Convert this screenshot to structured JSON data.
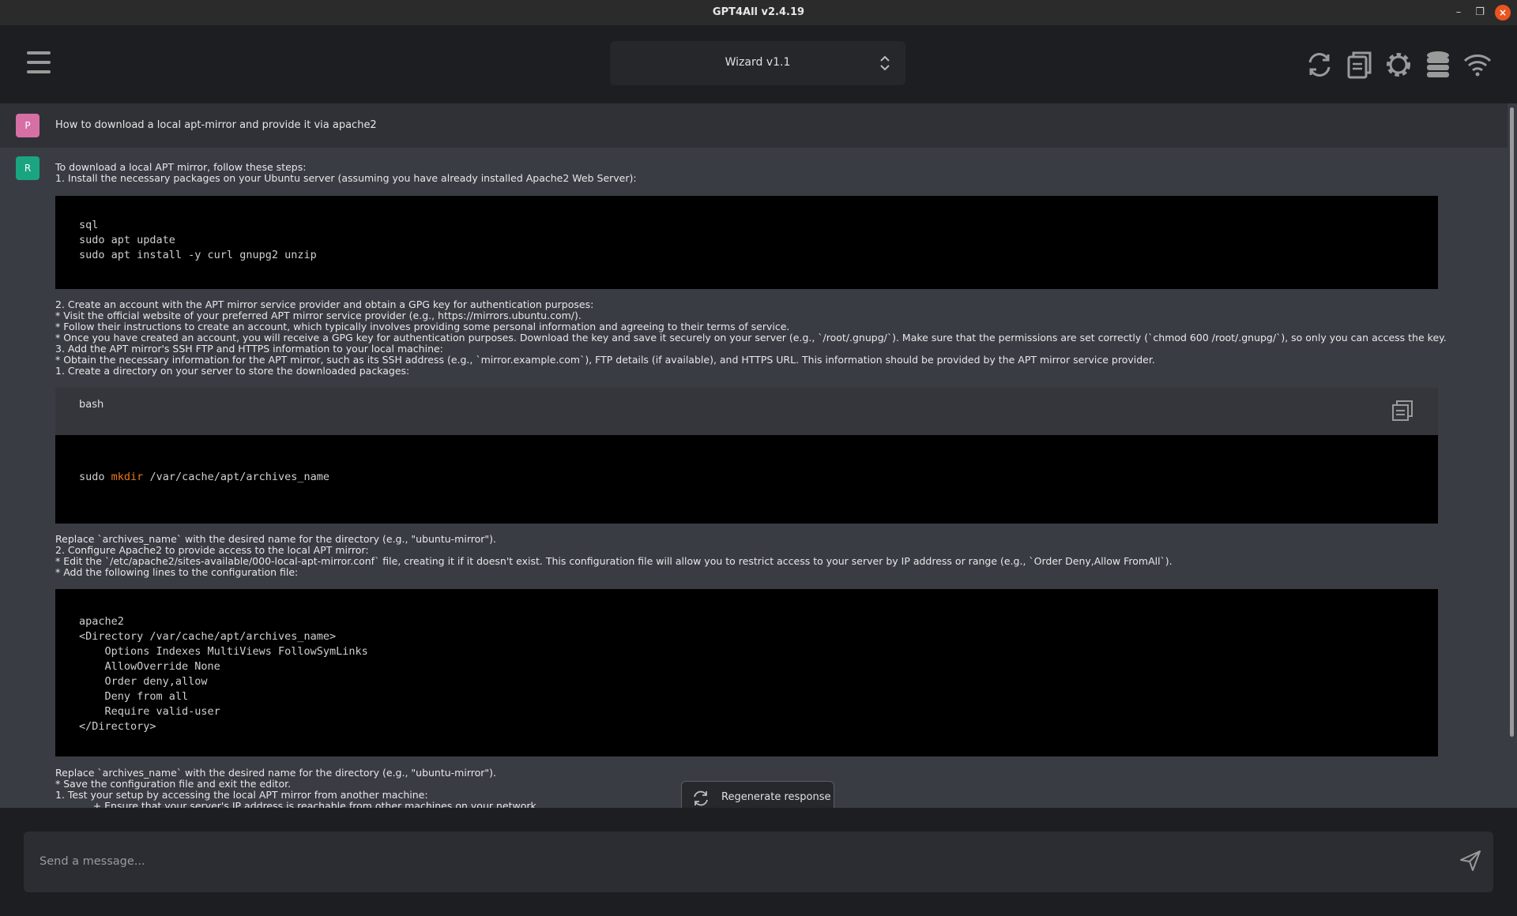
{
  "window": {
    "title": "GPT4All v2.4.19",
    "minimize": "–",
    "maximize": "❐",
    "close": "×"
  },
  "header": {
    "model_name": "Wizard v1.1"
  },
  "conversation": {
    "prompt_avatar": "P",
    "prompt_text": "How to download a local apt-mirror and provide it via apache2",
    "response_avatar": "R",
    "p1": "To download a local APT mirror, follow these steps:\n1. Install the necessary packages on your Ubuntu server (assuming you have already installed Apache2 Web Server):",
    "code1": "sql\nsudo apt update\nsudo apt install -y curl gnupg2 unzip",
    "p2": "2. Create an account with the APT mirror service provider and obtain a GPG key for authentication purposes:\n* Visit the official website of your preferred APT mirror service provider (e.g., https://mirrors.ubuntu.com/).\n* Follow their instructions to create an account, which typically involves providing some personal information and agreeing to their terms of service.\n* Once you have created an account, you will receive a GPG key for authentication purposes. Download the key and save it securely on your server (e.g., `/root/.gnupg/`). Make sure that the permissions are set correctly (`chmod 600 /root/.gnupg/`), so only you can access the key.\n3. Add the APT mirror's SSH FTP and HTTPS information to your local machine:\n* Obtain the necessary information for the APT mirror, such as its SSH address (e.g., `mirror.example.com`), FTP details (if available), and HTTPS URL. This information should be provided by the APT mirror service provider.\n1. Create a directory on your server to store the downloaded packages:",
    "code2_lang": "bash",
    "code2_cmd": "sudo",
    "code2_kw": "mkdir",
    "code2_arg": "/var/cache/apt/archives_name",
    "p3": "Replace `archives_name` with the desired name for the directory (e.g., \"ubuntu-mirror\").\n2. Configure Apache2 to provide access to the local APT mirror:\n* Edit the `/etc/apache2/sites-available/000-local-apt-mirror.conf` file, creating it if it doesn't exist. This configuration file will allow you to restrict access to your server by IP address or range (e.g., `Order Deny,Allow FromAll`).\n* Add the following lines to the configuration file:",
    "code3": "apache2\n<Directory /var/cache/apt/archives_name>\n    Options Indexes MultiViews FollowSymLinks\n    AllowOverride None\n    Order deny,allow\n    Deny from all\n    Require valid-user\n</Directory>",
    "p4": "Replace `archives_name` with the desired name for the directory (e.g., \"ubuntu-mirror\").\n* Save the configuration file and exit the editor.\n1. Test your setup by accessing the local APT mirror from another machine:\n            + Ensure that your server's IP address is reachable from other machines on your network."
  },
  "regenerate_label": "Regenerate response",
  "input": {
    "placeholder": "Send a message..."
  },
  "icons": [
    "menu-icon",
    "chevron-updown-icon",
    "reset-icon",
    "copy-icon",
    "settings-icon",
    "database-icon",
    "wifi-icon",
    "send-icon"
  ],
  "colors": {
    "accent": "#e5771e",
    "prompt_avatar": "#d66fa4",
    "response_avatar": "#1aa580"
  }
}
